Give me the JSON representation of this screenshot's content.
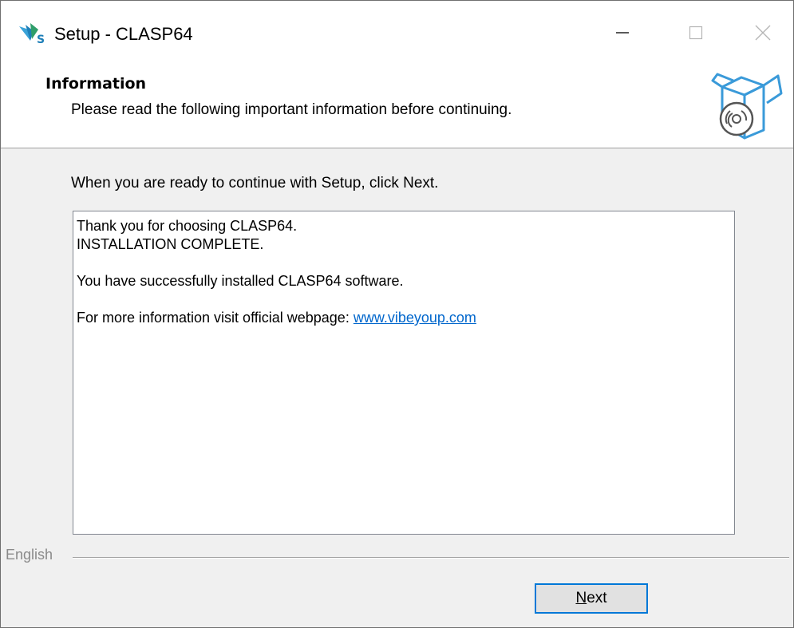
{
  "window": {
    "title": "Setup - CLASP64",
    "controls": {
      "minimize_icon": "minimize-icon",
      "maximize_icon": "maximize-icon",
      "close_icon": "close-icon"
    }
  },
  "header": {
    "title": "Information",
    "subtitle": "Please read the following important information before continuing.",
    "icon": "install-box-icon"
  },
  "body": {
    "intro": "When you are ready to continue with Setup, click Next.",
    "memo": {
      "line1": "Thank you for choosing CLASP64.",
      "line2": "INSTALLATION COMPLETE.",
      "line3": "You have successfully installed CLASP64 software.",
      "line4_prefix": "For more information visit official webpage: ",
      "link_text": "www.vibeyoup.com"
    }
  },
  "footer": {
    "language_label": "English",
    "next_label": "Next"
  },
  "colors": {
    "accent": "#0078d7",
    "link": "#0066cc",
    "header_bg": "#ffffff",
    "body_bg": "#f0f0f0"
  }
}
